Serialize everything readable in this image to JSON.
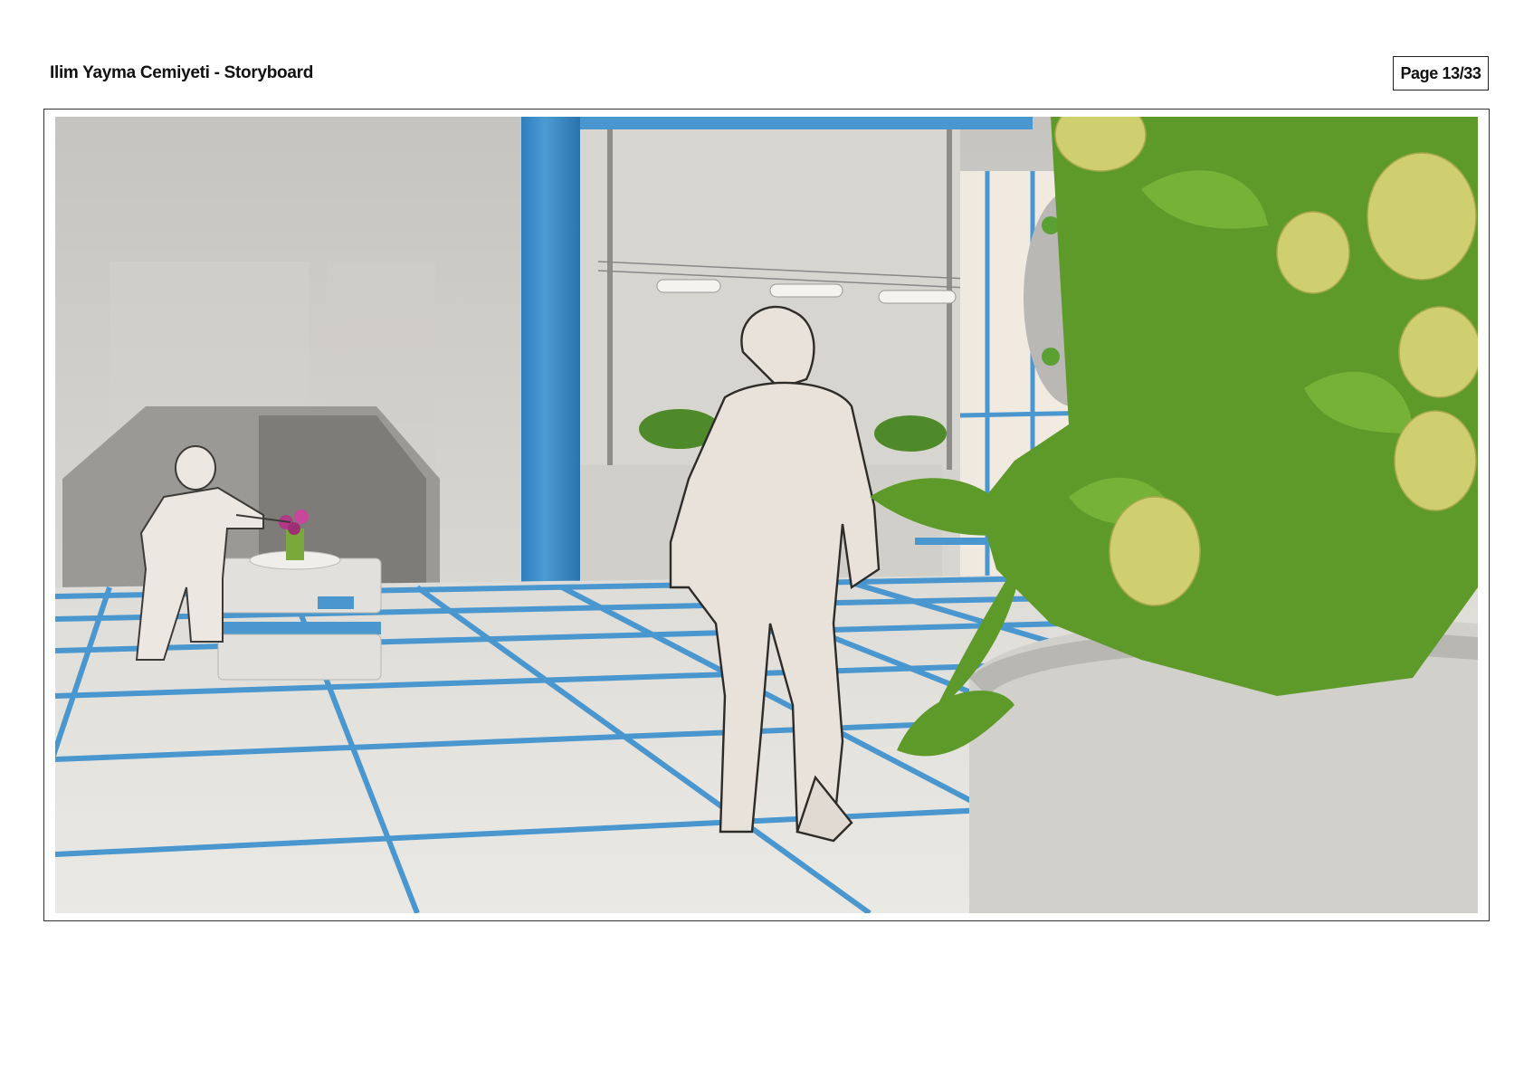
{
  "header": {
    "title": "Ilim Yayma Cemiyeti - Storyboard",
    "page_label": "Page 13/33"
  },
  "panel": {
    "scene": "storyboard-frame",
    "colors": {
      "wall": "#cfcdc9",
      "floor": "#e3e1dc",
      "grid_blue": "#4a97cf",
      "leaf": "#5e9a2a",
      "lemon": "#cfcf6f"
    }
  }
}
